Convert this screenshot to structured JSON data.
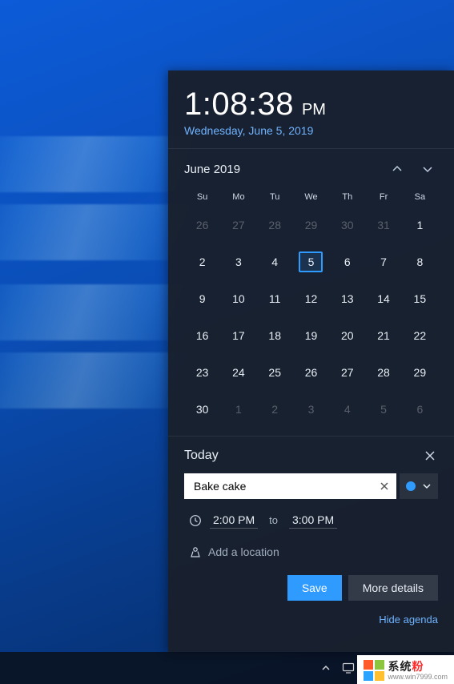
{
  "clock": {
    "time": "1:08:38",
    "ampm": "PM",
    "date": "Wednesday, June 5, 2019"
  },
  "calendar": {
    "month_label": "June 2019",
    "dow": [
      "Su",
      "Mo",
      "Tu",
      "We",
      "Th",
      "Fr",
      "Sa"
    ],
    "weeks": [
      [
        {
          "d": "26",
          "dim": true
        },
        {
          "d": "27",
          "dim": true
        },
        {
          "d": "28",
          "dim": true
        },
        {
          "d": "29",
          "dim": true
        },
        {
          "d": "30",
          "dim": true
        },
        {
          "d": "31",
          "dim": true
        },
        {
          "d": "1"
        }
      ],
      [
        {
          "d": "2"
        },
        {
          "d": "3"
        },
        {
          "d": "4"
        },
        {
          "d": "5",
          "sel": true
        },
        {
          "d": "6"
        },
        {
          "d": "7"
        },
        {
          "d": "8"
        }
      ],
      [
        {
          "d": "9"
        },
        {
          "d": "10"
        },
        {
          "d": "11"
        },
        {
          "d": "12"
        },
        {
          "d": "13"
        },
        {
          "d": "14"
        },
        {
          "d": "15"
        }
      ],
      [
        {
          "d": "16"
        },
        {
          "d": "17"
        },
        {
          "d": "18"
        },
        {
          "d": "19"
        },
        {
          "d": "20"
        },
        {
          "d": "21"
        },
        {
          "d": "22"
        }
      ],
      [
        {
          "d": "23"
        },
        {
          "d": "24"
        },
        {
          "d": "25"
        },
        {
          "d": "26"
        },
        {
          "d": "27"
        },
        {
          "d": "28"
        },
        {
          "d": "29"
        }
      ],
      [
        {
          "d": "30"
        },
        {
          "d": "1",
          "dim": true
        },
        {
          "d": "2",
          "dim": true
        },
        {
          "d": "3",
          "dim": true
        },
        {
          "d": "4",
          "dim": true
        },
        {
          "d": "5",
          "dim": true
        },
        {
          "d": "6",
          "dim": true
        }
      ]
    ]
  },
  "agenda": {
    "title": "Today",
    "event_name": "Bake cake",
    "start_time": "2:00 PM",
    "to_label": "to",
    "end_time": "3:00 PM",
    "location_placeholder": "Add a location",
    "save_label": "Save",
    "more_label": "More details",
    "hide_label": "Hide agenda",
    "calendar_color": "#2f9bff"
  },
  "watermark": {
    "text_prefix": "系统",
    "text_accent": "粉",
    "url": "www.win7999.com",
    "colors": [
      "#ff5a2a",
      "#8cc63f",
      "#2aa4ff",
      "#ffbf2f"
    ]
  }
}
